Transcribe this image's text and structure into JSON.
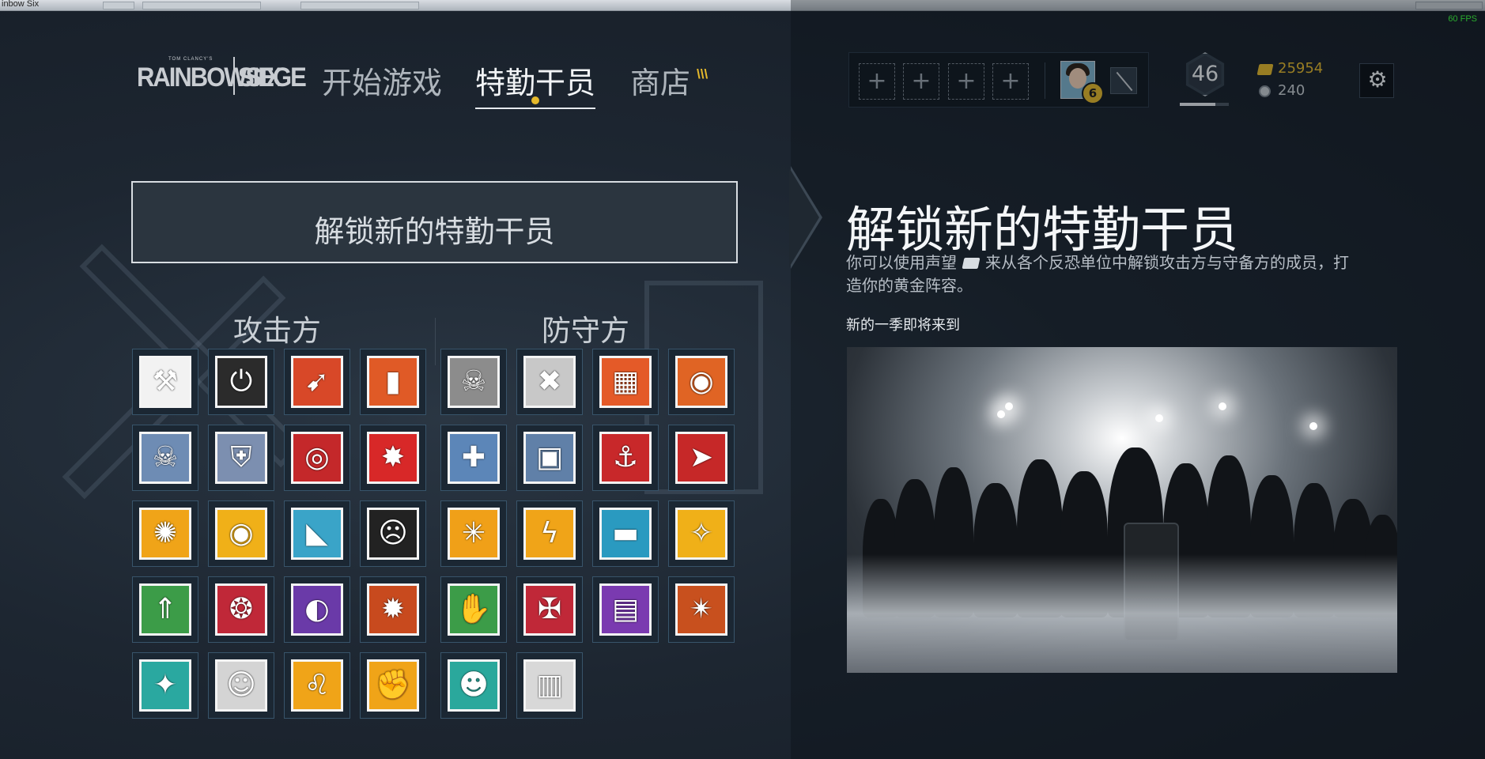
{
  "window": {
    "title": "inbow Six",
    "fps": "60 FPS"
  },
  "header": {
    "logo_small": "TOM CLANCY'S",
    "logo_main": "RAINBOWSIX",
    "logo_siege": "SIEGE",
    "nav": [
      {
        "label": "开始游戏",
        "active": false
      },
      {
        "label": "特勤干员",
        "active": true
      },
      {
        "label": "商店",
        "active": false
      }
    ],
    "new_marker": "\\\\\\",
    "squad_slot_symbol": "+",
    "player_level": "46",
    "level_progress": 0.72,
    "renown": "25954",
    "credits": "240",
    "settings_icon": "⚙"
  },
  "left": {
    "unlock_button": "解锁新的特勤干员",
    "attackers_title": "攻击方",
    "defenders_title": "防守方",
    "attackers": [
      {
        "icon": "breacher-hammer-icon",
        "glyph": "⚒",
        "bg": "#f2f2f2"
      },
      {
        "icon": "shield-power-icon",
        "glyph": "⏻",
        "bg": "#2b2b2b"
      },
      {
        "icon": "arrow-breach-icon",
        "glyph": "➹",
        "bg": "#d84828"
      },
      {
        "icon": "torn-wall-icon",
        "glyph": "▮",
        "bg": "#e05a26"
      },
      {
        "icon": "skull-drone-icon",
        "glyph": "☠",
        "bg": "#6e8cb4"
      },
      {
        "icon": "shield-crest-icon",
        "glyph": "⛨",
        "bg": "#7c8fb0"
      },
      {
        "icon": "target-crosshair-icon",
        "glyph": "◎",
        "bg": "#c4282a"
      },
      {
        "icon": "fragment-icon",
        "glyph": "✸",
        "bg": "#d82828"
      },
      {
        "icon": "flash-burst-icon",
        "glyph": "✺",
        "bg": "#f0a418"
      },
      {
        "icon": "eyes-mask-icon",
        "glyph": "◉",
        "bg": "#f0b018"
      },
      {
        "icon": "shark-icon",
        "glyph": "◣",
        "bg": "#3aa4c8"
      },
      {
        "icon": "scream-mask-icon",
        "glyph": "☹",
        "bg": "#222222"
      },
      {
        "icon": "arrow-up-icon",
        "glyph": "⇑",
        "bg": "#3c9c48"
      },
      {
        "icon": "cluster-charge-icon",
        "glyph": "❂",
        "bg": "#c02838"
      },
      {
        "icon": "swirl-eye-icon",
        "glyph": "◐",
        "bg": "#6a3aa8"
      },
      {
        "icon": "gears-burst-icon",
        "glyph": "✹",
        "bg": "#c84a1e"
      },
      {
        "icon": "eagle-wings-icon",
        "glyph": "✦",
        "bg": "#2aa8a0"
      },
      {
        "icon": "goggles-face-icon",
        "glyph": "☺",
        "bg": "#d4d4d4"
      },
      {
        "icon": "lion-head-icon",
        "glyph": "♌",
        "bg": "#f0a418"
      },
      {
        "icon": "fist-icon",
        "glyph": "✊",
        "bg": "#f0a418"
      }
    ],
    "defenders": [
      {
        "icon": "gas-skull-icon",
        "glyph": "☠",
        "bg": "#8c8c8c"
      },
      {
        "icon": "crossed-mask-icon",
        "glyph": "✖",
        "bg": "#c8c8c8"
      },
      {
        "icon": "castle-wall-icon",
        "glyph": "▦",
        "bg": "#e45a28"
      },
      {
        "icon": "eye-scan-icon",
        "glyph": "◉",
        "bg": "#e06424"
      },
      {
        "icon": "medic-cross-icon",
        "glyph": "✚",
        "bg": "#5c86b8"
      },
      {
        "icon": "vest-icon",
        "glyph": "▣",
        "bg": "#6080a8"
      },
      {
        "icon": "hook-trap-icon",
        "glyph": "⚓",
        "bg": "#c8282a"
      },
      {
        "icon": "drill-icon",
        "glyph": "➤",
        "bg": "#c62828"
      },
      {
        "icon": "web-icon",
        "glyph": "✳",
        "bg": "#f0a018"
      },
      {
        "icon": "lightning-icon",
        "glyph": "ϟ",
        "bg": "#f0a418"
      },
      {
        "icon": "barricade-icon",
        "glyph": "▬",
        "bg": "#2a9ac0"
      },
      {
        "icon": "wing-crest-icon",
        "glyph": "✧",
        "bg": "#f0b018"
      },
      {
        "icon": "blade-hand-icon",
        "glyph": "✋",
        "bg": "#3c9c48"
      },
      {
        "icon": "crossed-skull-icon",
        "glyph": "✠",
        "bg": "#c02838"
      },
      {
        "icon": "striped-panel-icon",
        "glyph": "▤",
        "bg": "#7a3ab0"
      },
      {
        "icon": "compass-star-icon",
        "glyph": "✴",
        "bg": "#c8501e"
      },
      {
        "icon": "grin-face-icon",
        "glyph": "☻",
        "bg": "#2aa89c"
      },
      {
        "icon": "panels-icon",
        "glyph": "▥",
        "bg": "#d8d8d8"
      }
    ]
  },
  "right": {
    "title": "解锁新的特勤干员",
    "desc_part1": "你可以使用声望",
    "desc_part2": "来从各个反恐单位中解锁攻击方与守备方的成员，打造你的黄金阵容。",
    "season_label": "新的一季即将来到"
  }
}
